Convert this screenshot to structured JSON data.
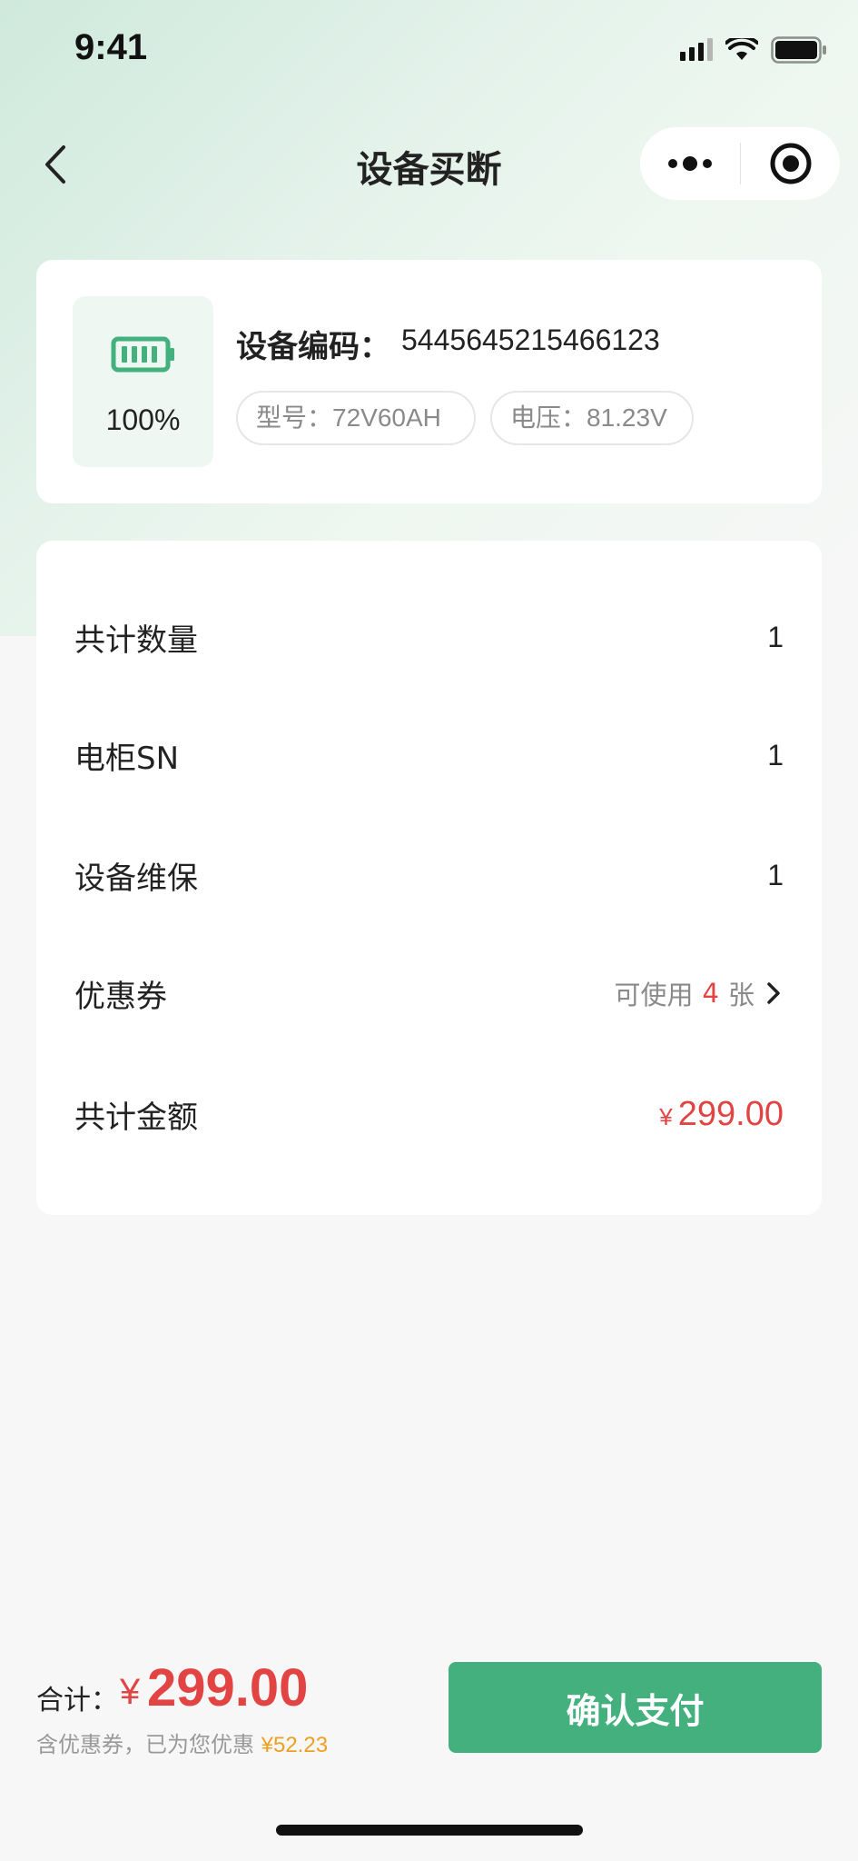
{
  "status_bar": {
    "time": "9:41"
  },
  "nav": {
    "title": "设备买断"
  },
  "device": {
    "battery_percent": "100%",
    "code_label": "设备编码：",
    "code_value": "5445645215466123",
    "model_tag": "型号：72V60AH",
    "voltage_tag": "电压：81.23V"
  },
  "order": {
    "rows": [
      {
        "label": "共计数量",
        "value": "1"
      },
      {
        "label": "电柜SN",
        "value": "1"
      },
      {
        "label": "设备维保",
        "value": "1"
      }
    ],
    "coupon": {
      "label": "优惠券",
      "prefix": "可使用",
      "count": "4",
      "suffix": "张"
    },
    "total": {
      "label": "共计金额",
      "currency": "¥",
      "amount": "299.00"
    }
  },
  "footer": {
    "total_label": "合计：",
    "currency": "¥",
    "total_amount": "299.00",
    "discount_text": "含优惠券，已为您优惠",
    "discount_amount": "¥52.23",
    "pay_button": "确认支付"
  },
  "colors": {
    "accent_green": "#43b07e",
    "price_red": "#e24444",
    "discount_orange": "#f0a020"
  }
}
